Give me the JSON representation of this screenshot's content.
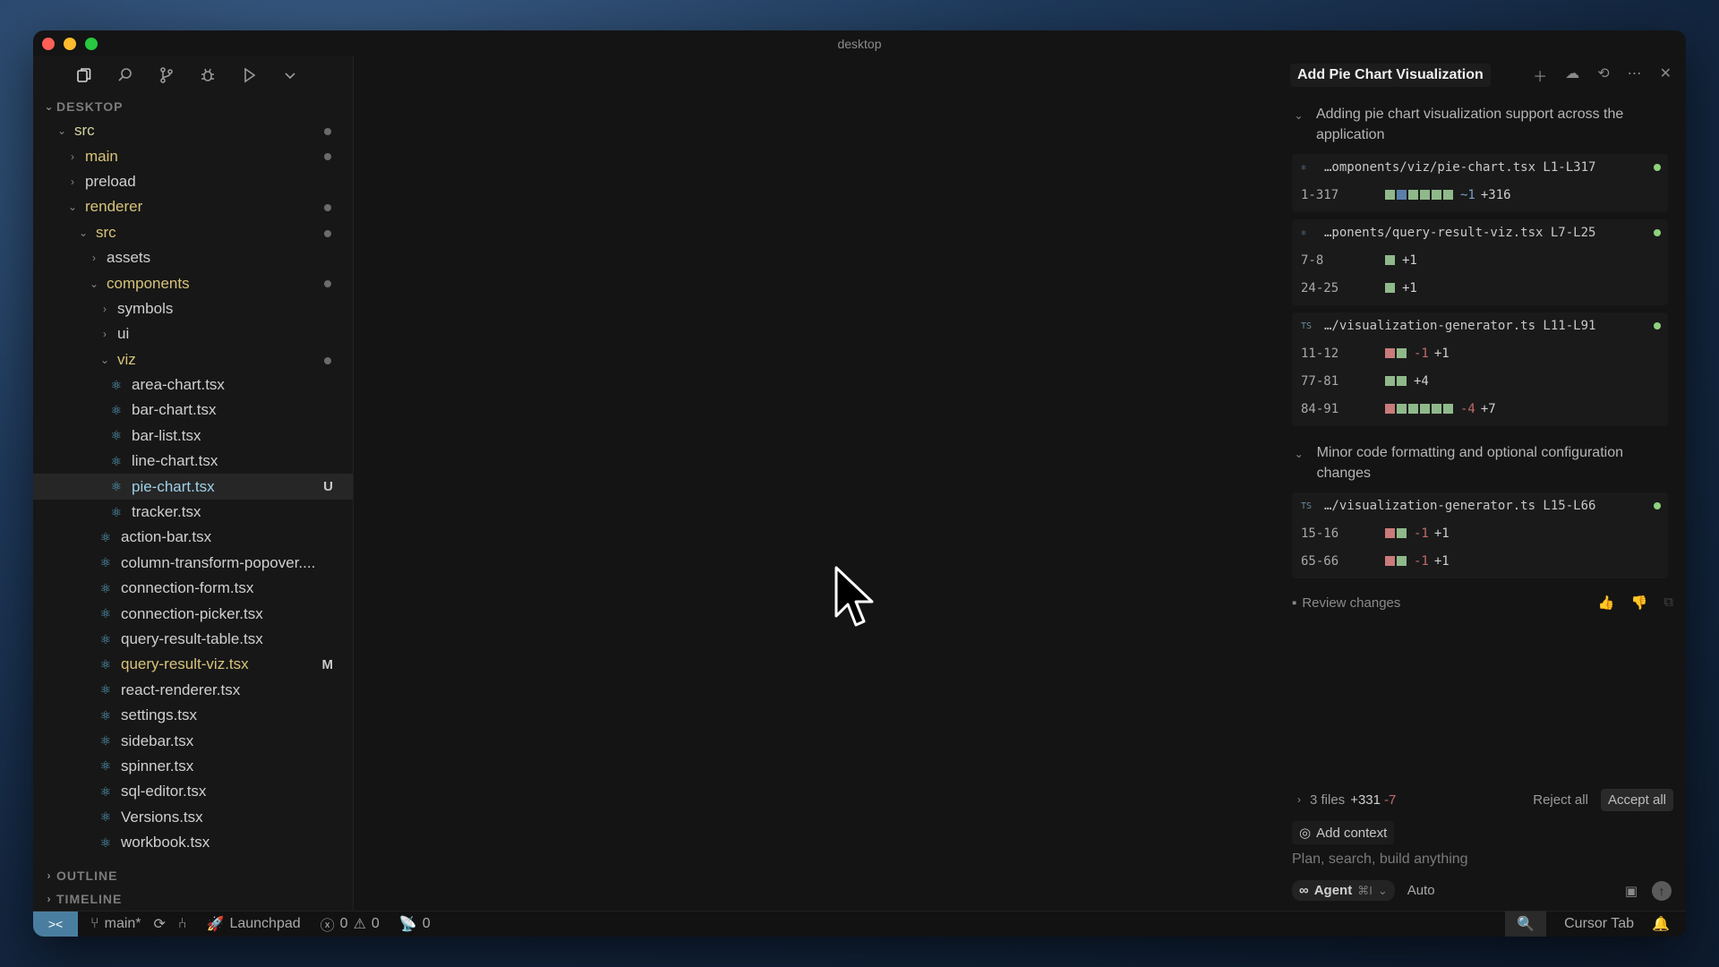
{
  "window": {
    "title": "desktop"
  },
  "sidebar": {
    "section": "DESKTOP",
    "tree": [
      {
        "label": "src",
        "depth": 0,
        "type": "folder-open",
        "dot": true,
        "color": "folder"
      },
      {
        "label": "main",
        "depth": 1,
        "type": "folder",
        "dot": true,
        "color": "mod"
      },
      {
        "label": "preload",
        "depth": 1,
        "type": "folder",
        "color": "plain"
      },
      {
        "label": "renderer",
        "depth": 1,
        "type": "folder-open",
        "dot": true,
        "color": "mod"
      },
      {
        "label": "src",
        "depth": 2,
        "type": "folder-open",
        "dot": true,
        "color": "mod"
      },
      {
        "label": "assets",
        "depth": 3,
        "type": "folder",
        "color": "plain"
      },
      {
        "label": "components",
        "depth": 3,
        "type": "folder-open",
        "dot": true,
        "color": "mod"
      },
      {
        "label": "symbols",
        "depth": 4,
        "type": "folder",
        "color": "plain"
      },
      {
        "label": "ui",
        "depth": 4,
        "type": "folder",
        "color": "plain"
      },
      {
        "label": "viz",
        "depth": 4,
        "type": "folder-open",
        "dot": true,
        "color": "mod"
      },
      {
        "label": "area-chart.tsx",
        "depth": 5,
        "type": "file",
        "color": "plain"
      },
      {
        "label": "bar-chart.tsx",
        "depth": 5,
        "type": "file",
        "color": "plain"
      },
      {
        "label": "bar-list.tsx",
        "depth": 5,
        "type": "file",
        "color": "plain"
      },
      {
        "label": "line-chart.tsx",
        "depth": 5,
        "type": "file",
        "color": "plain"
      },
      {
        "label": "pie-chart.tsx",
        "depth": 5,
        "type": "file",
        "color": "new",
        "badge": "U",
        "selected": true
      },
      {
        "label": "tracker.tsx",
        "depth": 5,
        "type": "file",
        "color": "plain"
      },
      {
        "label": "action-bar.tsx",
        "depth": 4,
        "type": "file",
        "color": "plain"
      },
      {
        "label": "column-transform-popover....",
        "depth": 4,
        "type": "file",
        "color": "plain"
      },
      {
        "label": "connection-form.tsx",
        "depth": 4,
        "type": "file",
        "color": "plain"
      },
      {
        "label": "connection-picker.tsx",
        "depth": 4,
        "type": "file",
        "color": "plain"
      },
      {
        "label": "query-result-table.tsx",
        "depth": 4,
        "type": "file",
        "color": "plain"
      },
      {
        "label": "query-result-viz.tsx",
        "depth": 4,
        "type": "file",
        "color": "mod",
        "badge": "M"
      },
      {
        "label": "react-renderer.tsx",
        "depth": 4,
        "type": "file",
        "color": "plain"
      },
      {
        "label": "settings.tsx",
        "depth": 4,
        "type": "file",
        "color": "plain"
      },
      {
        "label": "sidebar.tsx",
        "depth": 4,
        "type": "file",
        "color": "plain"
      },
      {
        "label": "spinner.tsx",
        "depth": 4,
        "type": "file",
        "color": "plain"
      },
      {
        "label": "sql-editor.tsx",
        "depth": 4,
        "type": "file",
        "color": "plain"
      },
      {
        "label": "Versions.tsx",
        "depth": 4,
        "type": "file",
        "color": "plain"
      },
      {
        "label": "workbook.tsx",
        "depth": 4,
        "type": "file",
        "color": "plain"
      }
    ],
    "outline": "OUTLINE",
    "timeline": "TIMELINE"
  },
  "panel": {
    "title": "Add Pie Chart Visualization",
    "groups": [
      {
        "heading": "Adding pie chart visualization support across the application",
        "cards": [
          {
            "file": "…omponents/viz/pie-chart.tsx L1-L317",
            "icon": "⚛",
            "hunks": [
              {
                "range": "1-317",
                "squares": "gbgggg",
                "del": "",
                "mod": "~1",
                "add": "+316"
              }
            ]
          },
          {
            "file": "…ponents/query-result-viz.tsx L7-L25",
            "icon": "⚛",
            "hunks": [
              {
                "range": "7-8",
                "squares": "g",
                "del": "",
                "mod": "",
                "add": "+1"
              },
              {
                "range": "24-25",
                "squares": "g",
                "del": "",
                "mod": "",
                "add": "+1"
              }
            ]
          },
          {
            "file": "…/visualization-generator.ts L11-L91",
            "icon": "TS",
            "hunks": [
              {
                "range": "11-12",
                "squares": "rg",
                "del": "-1",
                "mod": "",
                "add": "+1"
              },
              {
                "range": "77-81",
                "squares": "gg",
                "del": "",
                "mod": "",
                "add": "+4"
              },
              {
                "range": "84-91",
                "squares": "rggggg",
                "del": "-4",
                "mod": "",
                "add": "+7"
              }
            ]
          }
        ]
      },
      {
        "heading": "Minor code formatting and optional configuration changes",
        "cards": [
          {
            "file": "…/visualization-generator.ts L15-L66",
            "icon": "TS",
            "hunks": [
              {
                "range": "15-16",
                "squares": "rg",
                "del": "-1",
                "mod": "",
                "add": "+1"
              },
              {
                "range": "65-66",
                "squares": "rg",
                "del": "-1",
                "mod": "",
                "add": "+1"
              }
            ]
          }
        ]
      }
    ],
    "review_label": "Review changes",
    "summary": {
      "files": "3 files",
      "add": "+331",
      "del": "-7",
      "reject": "Reject all",
      "accept": "Accept all"
    },
    "composer": {
      "add_context": "Add context",
      "placeholder": "Plan, search, build anything",
      "agent": "Agent",
      "agent_shortcut": "⌘I",
      "model": "Auto"
    }
  },
  "statusbar": {
    "branch": "main*",
    "launchpad": "Launchpad",
    "errors": "0",
    "warnings": "0",
    "ports": "0",
    "cursor_tab": "Cursor Tab"
  },
  "colors": {
    "accent": "#4a7ea0",
    "added": "#8fb98a",
    "deleted": "#c97a7a",
    "modified_text": "#d7c37a",
    "untracked_text": "#9fd0e8"
  }
}
